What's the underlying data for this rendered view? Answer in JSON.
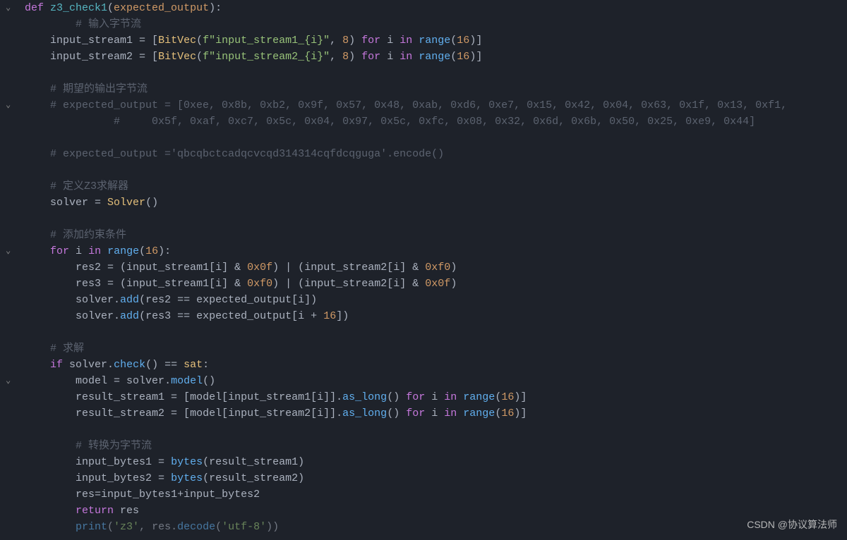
{
  "watermark": "CSDN @协议算法师",
  "fold_positions": [
    0,
    6,
    15,
    23
  ],
  "code": {
    "fn_name": "z3_check1",
    "param": "expected_output",
    "cmt_input": "# 输入字节流",
    "input1_lhs": "input_stream1",
    "input2_lhs": "input_stream2",
    "bitvec": "BitVec",
    "fstr1": "f\"input_stream1_{i}\"",
    "fstr2": "f\"input_stream2_{i}\"",
    "eight": "8",
    "sixteen": "16",
    "range": "range",
    "for": "for",
    "in": "in",
    "i": "i",
    "cmt_expected_hdr": "# 期望的输出字节流",
    "cmt_expected_line1": "# expected_output = [0xee, 0x8b, 0xb2, 0x9f, 0x57, 0x48, 0xab, 0xd6, 0xe7, 0x15, 0x42, 0x04, 0x63, 0x1f, 0x13, 0xf1,",
    "cmt_expected_line2": "#     0x5f, 0xaf, 0xc7, 0x5c, 0x04, 0x97, 0x5c, 0xfc, 0x08, 0x32, 0x6d, 0x6b, 0x50, 0x25, 0xe9, 0x44]",
    "cmt_expected_str": "# expected_output ='qbcqbctcadqcvcqd314314cqfdcqguga'.encode()",
    "cmt_z3solver": "# 定义Z3求解器",
    "solver_var": "solver",
    "solver_cls": "Solver",
    "cmt_constraints": "# 添加约束条件",
    "res2": "res2",
    "res3": "res3",
    "hex0f": "0x0f",
    "hexf0": "0xf0",
    "add": "add",
    "expected_output": "expected_output",
    "plus16": "16",
    "cmt_solve": "# 求解",
    "check": "check",
    "sat": "sat",
    "model_var": "model",
    "model_fn": "model",
    "result1": "result_stream1",
    "result2": "result_stream2",
    "as_long": "as_long",
    "cmt_bytes": "# 转换为字节流",
    "ib1": "input_bytes1",
    "ib2": "input_bytes2",
    "bytes": "bytes",
    "res": "res",
    "return": "return",
    "print": "print",
    "z3str": "'z3'",
    "decode": "decode",
    "utf8": "'utf-8'"
  }
}
